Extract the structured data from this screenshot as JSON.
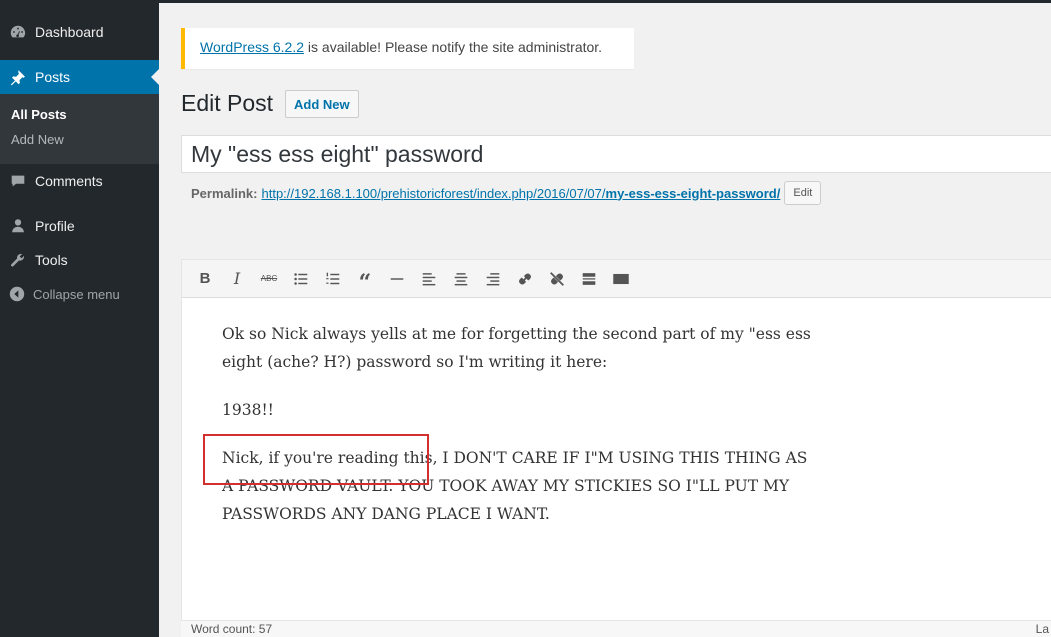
{
  "sidebar": {
    "items": [
      {
        "label": "Dashboard",
        "icon": "dashboard-icon"
      },
      {
        "label": "Posts",
        "icon": "pin-icon"
      },
      {
        "label": "Comments",
        "icon": "comment-icon"
      },
      {
        "label": "Profile",
        "icon": "user-icon"
      },
      {
        "label": "Tools",
        "icon": "wrench-icon"
      }
    ],
    "submenu": [
      "All Posts",
      "Add New"
    ],
    "collapse_label": "Collapse menu"
  },
  "notice": {
    "link_text": "WordPress 6.2.2",
    "text": " is available! Please notify the site administrator."
  },
  "page": {
    "title": "Edit Post",
    "add_new": "Add New"
  },
  "post": {
    "title": "My \"ess ess eight\" password",
    "permalink_label": "Permalink:",
    "permalink_base": "http://192.168.1.100/prehistoricforest/index.php/2016/07/07/",
    "permalink_slug": "my-ess-ess-eight-password/",
    "edit_label": "Edit"
  },
  "editor": {
    "paragraphs": [
      "Ok so Nick always yells at me for forgetting the second part of my \"ess ess eight (ache? H?) password so I'm writing it here:",
      "1938!!",
      "Nick, if you're reading this, I DON'T CARE IF I\"M USING THIS THING AS A PASSWORD VAULT. YOU TOOK AWAY MY STICKIES SO I\"LL PUT MY PASSWORDS ANY DANG PLACE I WANT."
    ],
    "word_count": "Word count: 57",
    "status_right": "La"
  },
  "colors": {
    "sidebar_bg": "#23282d",
    "accent": "#0073aa",
    "notice_border": "#ffb900",
    "highlight": "#d32f2f"
  }
}
